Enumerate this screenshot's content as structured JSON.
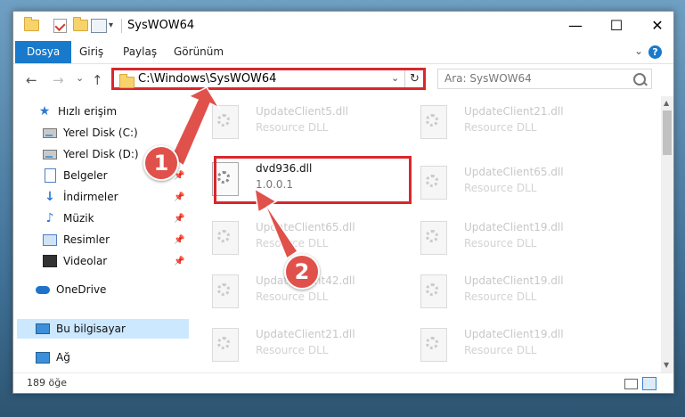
{
  "window": {
    "title": "SysWOW64",
    "minimize": "—",
    "maximize": "☐",
    "close": "✕"
  },
  "ribbon": {
    "tabs": [
      "Dosya",
      "Giriş",
      "Paylaş",
      "Görünüm"
    ],
    "collapse_glyph": "⌄",
    "help_glyph": "?"
  },
  "navigation": {
    "back": "←",
    "forward": "→",
    "recent": "⌄",
    "up": "↑",
    "address": "C:\\Windows\\SysWOW64",
    "address_dropdown": "⌄",
    "refresh": "↻",
    "search_placeholder": "Ara: SysWOW64"
  },
  "sidebar": {
    "items": [
      {
        "label": "Hızlı erişim",
        "icon": "star-icon"
      },
      {
        "label": "Yerel Disk (C:)",
        "icon": "drive-icon"
      },
      {
        "label": "Yerel Disk (D:)",
        "icon": "drive-icon"
      },
      {
        "label": "Belgeler",
        "icon": "documents-icon"
      },
      {
        "label": "İndirmeler",
        "icon": "downloads-icon"
      },
      {
        "label": "Müzik",
        "icon": "music-icon"
      },
      {
        "label": "Resimler",
        "icon": "pictures-icon"
      },
      {
        "label": "Videolar",
        "icon": "videos-icon"
      },
      {
        "label": "OneDrive",
        "icon": "cloud-icon"
      },
      {
        "label": "Bu bilgisayar",
        "icon": "computer-icon"
      },
      {
        "label": "Ağ",
        "icon": "network-icon"
      }
    ],
    "pin_glyph": "📌",
    "selected": "Bu bilgisayar"
  },
  "files": {
    "highlighted": {
      "name": "dvd936.dll",
      "detail": "1.0.0.1"
    },
    "ghost": [
      {
        "name": "UpdateClient5.dll",
        "detail": "Resource DLL"
      },
      {
        "name": "UpdateClient21.dll",
        "detail": "Resource DLL"
      },
      {
        "name": "UpdateClient65.dll",
        "detail": "Resource DLL"
      },
      {
        "name": "UpdateClient65.dll",
        "detail": "Resource DLL"
      },
      {
        "name": "UpdateClient19.dll",
        "detail": "Resource DLL"
      },
      {
        "name": "UpdateClient42.dll",
        "detail": "Resource DLL"
      },
      {
        "name": "UpdateClient19.dll",
        "detail": "Resource DLL"
      },
      {
        "name": "UpdateClient21.dll",
        "detail": "Resource DLL"
      },
      {
        "name": "UpdateClient19.dll",
        "detail": "Resource DLL"
      }
    ]
  },
  "status": {
    "item_count": "189 öğe"
  },
  "callouts": [
    "1",
    "2"
  ],
  "colors": {
    "accent": "#1979ca",
    "highlight_border": "#d9272d",
    "badge": "#e0514b",
    "selection": "#cce8ff"
  }
}
